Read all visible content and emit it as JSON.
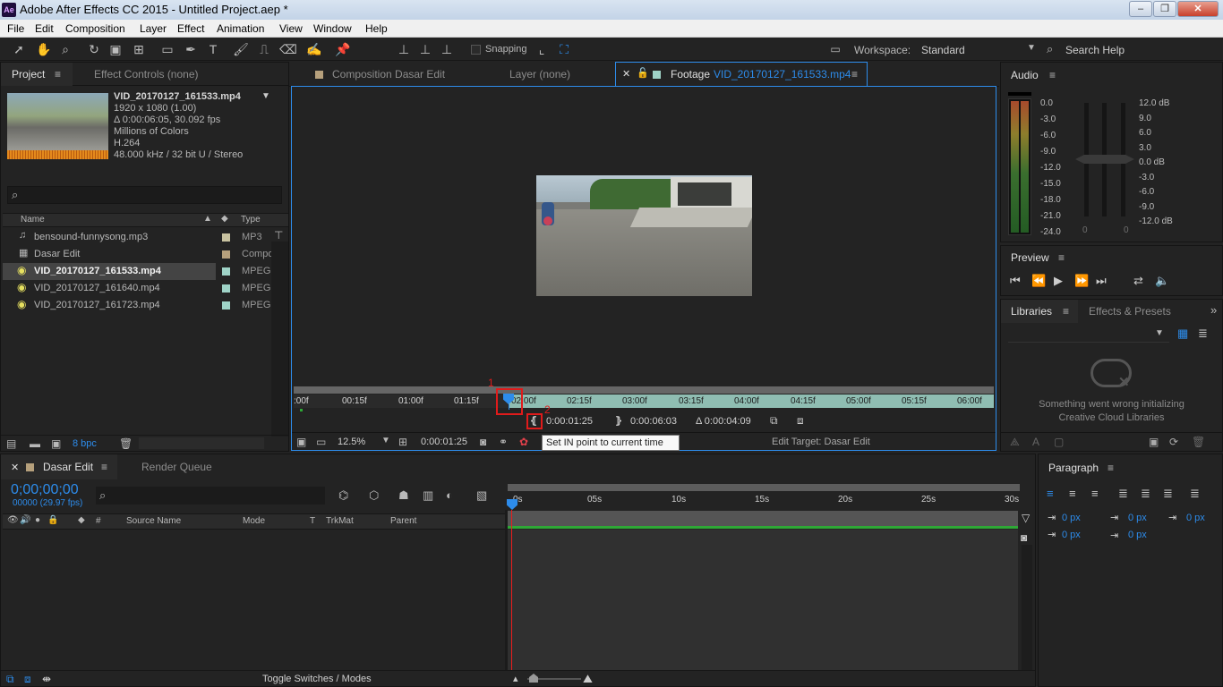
{
  "window": {
    "title": "Adobe After Effects CC 2015 - Untitled Project.aep *",
    "app_icon": "Ae"
  },
  "menu": [
    "File",
    "Edit",
    "Composition",
    "Layer",
    "Effect",
    "Animation",
    "View",
    "Window",
    "Help"
  ],
  "toolbar": {
    "snapping": "Snapping",
    "workspace_label": "Workspace:",
    "workspace_value": "Standard",
    "search_help": "Search Help"
  },
  "project_panel": {
    "tabs": [
      "Project",
      "Effect Controls (none)"
    ],
    "preview_name": "VID_20170127_161533.mp4",
    "preview_info": [
      "1920 x 1080 (1.00)",
      "Δ 0:00:06:05, 30.092 fps",
      "Millions of Colors",
      "H.264",
      "48.000 kHz / 32 bit U / Stereo"
    ],
    "columns": [
      "Name",
      "Type"
    ],
    "items": [
      {
        "name": "bensound-funnysong.mp3",
        "type": "MP3",
        "color": "#c8c2a0"
      },
      {
        "name": "Dasar Edit",
        "type": "Compo",
        "color": "#b6a07c"
      },
      {
        "name": "VID_20170127_161533.mp4",
        "type": "MPEG",
        "color": "#9fd3c7"
      },
      {
        "name": "VID_20170127_161640.mp4",
        "type": "MPEG",
        "color": "#9fd3c7"
      },
      {
        "name": "VID_20170127_161723.mp4",
        "type": "MPEG",
        "color": "#9fd3c7"
      }
    ],
    "bpc": "8 bpc"
  },
  "viewer": {
    "tabs": [
      "Composition Dasar Edit",
      "Layer (none)",
      "Footage"
    ],
    "footage_name": "VID_20170127_161533.mp4",
    "ruler_labels": [
      ":00f",
      "00:15f",
      "01:00f",
      "01:15f",
      "02:00f",
      "02:15f",
      "03:00f",
      "03:15f",
      "04:00f",
      "04:15f",
      "05:00f",
      "05:15f",
      "06:00f"
    ],
    "in_time": "0:00:01:25",
    "out_time": "0:00:06:03",
    "duration": "Δ 0:00:04:09",
    "zoom": "12.5%",
    "current_time": "0:00:01:25",
    "tooltip": "Set IN point to current time",
    "edit_target": "Edit Target: Dasar Edit",
    "annotation_1": "1",
    "annotation_2": "2"
  },
  "audio_panel": {
    "title": "Audio",
    "left_scale": [
      "0.0",
      "-3.0",
      "-6.0",
      "-9.0",
      "-12.0",
      "-15.0",
      "-18.0",
      "-21.0",
      "-24.0"
    ],
    "right_scale": [
      "12.0 dB",
      "9.0",
      "6.0",
      "3.0",
      "0.0 dB",
      "-3.0",
      "-6.0",
      "-9.0",
      "-12.0 dB"
    ],
    "fader_values": [
      "0",
      "0"
    ]
  },
  "preview_panel": {
    "title": "Preview"
  },
  "libraries_panel": {
    "tabs": [
      "Libraries",
      "Effects & Presets"
    ],
    "message": [
      "Something went wrong initializing",
      "Creative Cloud Libraries"
    ]
  },
  "timeline": {
    "tabs": [
      "Dasar Edit",
      "Render Queue"
    ],
    "timecode": "0;00;00;00",
    "fps": "00000 (29.97 fps)",
    "columns": [
      "#",
      "Source Name",
      "Mode",
      "T",
      "TrkMat",
      "Parent"
    ],
    "ruler": [
      "0s",
      "05s",
      "10s",
      "15s",
      "20s",
      "25s",
      "30s"
    ],
    "toggle": "Toggle Switches / Modes"
  },
  "paragraph_panel": {
    "title": "Paragraph",
    "values": [
      "0 px",
      "0 px",
      "0 px",
      "0 px",
      "0 px"
    ]
  },
  "colors": {
    "accent": "#2d8ceb",
    "green_bar": "#2ea836",
    "playhead": "#e81d1d",
    "annotation": "#e01b1b"
  }
}
